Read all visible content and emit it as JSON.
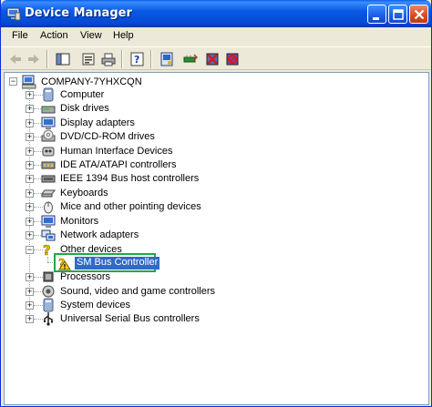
{
  "window": {
    "title": "Device Manager",
    "colors": {
      "titlebar": "#0a5ae4",
      "selection": "#316ac5",
      "highlight_box": "#1fa84a"
    }
  },
  "menu": [
    "File",
    "Action",
    "View",
    "Help"
  ],
  "toolbar": {
    "icons": [
      "back-arrow-icon",
      "forward-arrow-icon",
      "show-hide-console-tree-icon",
      "properties-icon",
      "print-icon",
      "help-icon",
      "scan-hardware-icon",
      "update-driver-icon",
      "uninstall-icon",
      "disable-device-icon"
    ]
  },
  "tree": {
    "root": "COMPANY-7YHXCQN",
    "categories": [
      {
        "label": "Computer",
        "icon": "computer-icon"
      },
      {
        "label": "Disk drives",
        "icon": "disk-drive-icon"
      },
      {
        "label": "Display adapters",
        "icon": "display-adapter-icon"
      },
      {
        "label": "DVD/CD-ROM drives",
        "icon": "cdrom-icon"
      },
      {
        "label": "Human Interface Devices",
        "icon": "hid-icon"
      },
      {
        "label": "IDE ATA/ATAPI controllers",
        "icon": "ide-controller-icon"
      },
      {
        "label": "IEEE 1394 Bus host controllers",
        "icon": "firewire-icon"
      },
      {
        "label": "Keyboards",
        "icon": "keyboard-icon"
      },
      {
        "label": "Mice and other pointing devices",
        "icon": "mouse-icon"
      },
      {
        "label": "Monitors",
        "icon": "monitor-icon"
      },
      {
        "label": "Network adapters",
        "icon": "network-adapter-icon"
      },
      {
        "label": "Other devices",
        "icon": "other-devices-icon",
        "expanded": true,
        "children": [
          {
            "label": "SM Bus Controller",
            "icon": "unknown-device-warning-icon",
            "selected": true
          }
        ]
      },
      {
        "label": "Processors",
        "icon": "processor-icon"
      },
      {
        "label": "Sound, video and game controllers",
        "icon": "sound-icon"
      },
      {
        "label": "System devices",
        "icon": "system-devices-icon"
      },
      {
        "label": "Universal Serial Bus controllers",
        "icon": "usb-icon"
      }
    ]
  }
}
